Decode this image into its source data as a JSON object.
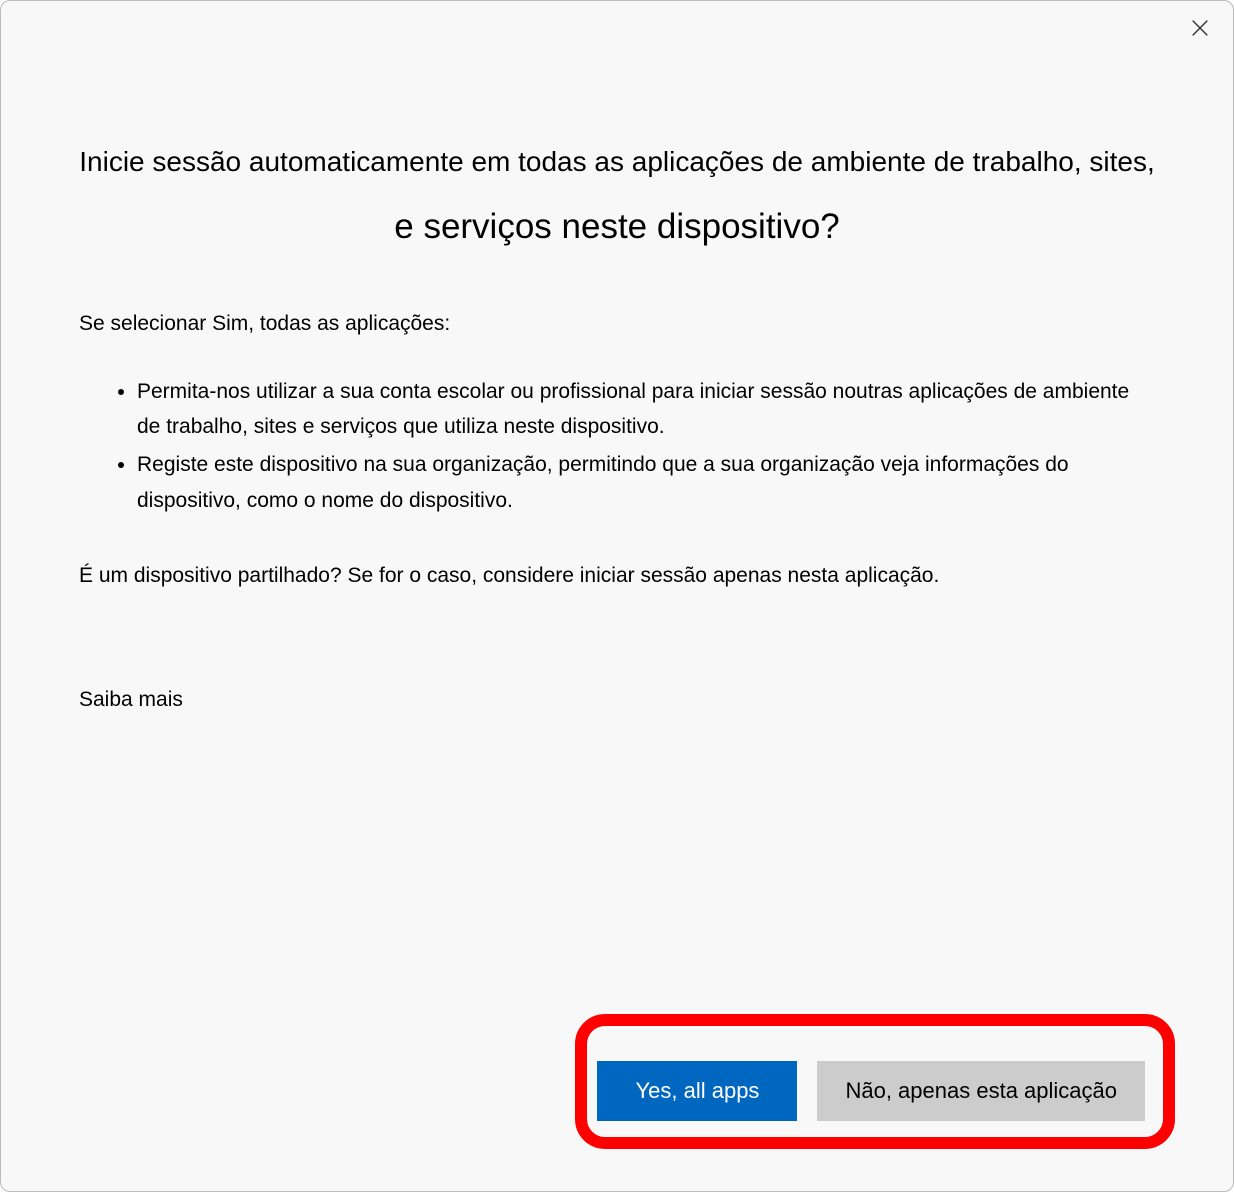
{
  "dialog": {
    "title_line1": "Inicie sessão automaticamente em todas as aplicações de ambiente de trabalho, sites,",
    "title_line2": "e serviços neste dispositivo?",
    "intro": "Se selecionar Sim, todas as aplicações:",
    "bullets": [
      "Permita-nos utilizar a sua conta escolar ou profissional para iniciar sessão noutras aplicações de ambiente de trabalho, sites e serviços que utiliza neste dispositivo.",
      "Registe este dispositivo na sua organização, permitindo que a sua organização veja informações do dispositivo, como o nome do dispositivo."
    ],
    "shared_device": "É um dispositivo partilhado? Se for o caso, considere iniciar sessão apenas nesta aplicação.",
    "learn_more": "Saiba mais",
    "buttons": {
      "yes": "Yes, all apps",
      "no": "Não, apenas esta aplicação"
    }
  }
}
